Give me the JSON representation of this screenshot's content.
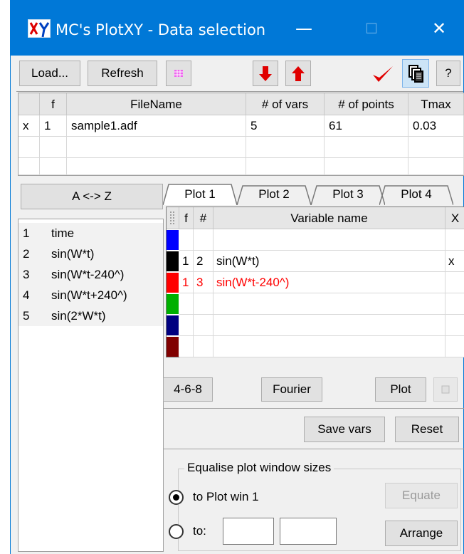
{
  "window": {
    "title": "MC's PlotXY - Data selection",
    "minimize": "—",
    "maximize": "☐",
    "close": "✕",
    "title_bar_color": "#0078d7"
  },
  "toolbar": {
    "load_label": "Load...",
    "refresh_label": "Refresh",
    "help_label": "?",
    "move_down_icon": "red-down-arrow-icon",
    "move_up_icon": "red-up-arrow-icon",
    "check_icon": "red-checkmark-icon",
    "copy_icon": "copy-pages-icon",
    "color_icon": "pink-grid-icon"
  },
  "file_table": {
    "headers": [
      "",
      "f",
      "FileName",
      "# of vars",
      "# of points",
      "Tmax"
    ],
    "rows": [
      [
        "x",
        "1",
        "sample1.adf",
        "5",
        "61",
        "0.03"
      ]
    ]
  },
  "sort_button": "A <-> Z",
  "variables": [
    {
      "num": "1",
      "name": "time"
    },
    {
      "num": "2",
      "name": "sin(W*t)"
    },
    {
      "num": "3",
      "name": "sin(W*t-240^)"
    },
    {
      "num": "4",
      "name": "sin(W*t+240^)"
    },
    {
      "num": "5",
      "name": "sin(2*W*t)"
    }
  ],
  "tabs": [
    "Plot 1",
    "Plot 2",
    "Plot 3",
    "Plot 4"
  ],
  "plot_table": {
    "headers": [
      "f",
      "#",
      "Variable name",
      "X"
    ],
    "rows": [
      {
        "color": "#0000ff",
        "f": "",
        "num": "",
        "name": "",
        "x": "",
        "text_color": "#000000"
      },
      {
        "color": "#000000",
        "f": "1",
        "num": "2",
        "name": "sin(W*t)",
        "x": "x",
        "text_color": "#000000"
      },
      {
        "color": "#ff0000",
        "f": "1",
        "num": "3",
        "name": "sin(W*t-240^)",
        "x": "",
        "text_color": "#ff0000"
      },
      {
        "color": "#00b000",
        "f": "",
        "num": "",
        "name": "",
        "x": "",
        "text_color": "#000000"
      },
      {
        "color": "#000080",
        "f": "",
        "num": "",
        "name": "",
        "x": "",
        "text_color": "#000000"
      },
      {
        "color": "#800000",
        "f": "",
        "num": "",
        "name": "",
        "x": "",
        "text_color": "#000000"
      }
    ]
  },
  "actions": {
    "b468": "4-6-8",
    "fourier": "Fourier",
    "plot": "Plot",
    "save_vars": "Save vars",
    "reset": "Reset"
  },
  "equalise": {
    "title": "Equalise plot window sizes",
    "option1": "to Plot win 1",
    "option2": "to:",
    "equate": "Equate",
    "arrange": "Arrange",
    "width_value": "",
    "height_value": ""
  }
}
